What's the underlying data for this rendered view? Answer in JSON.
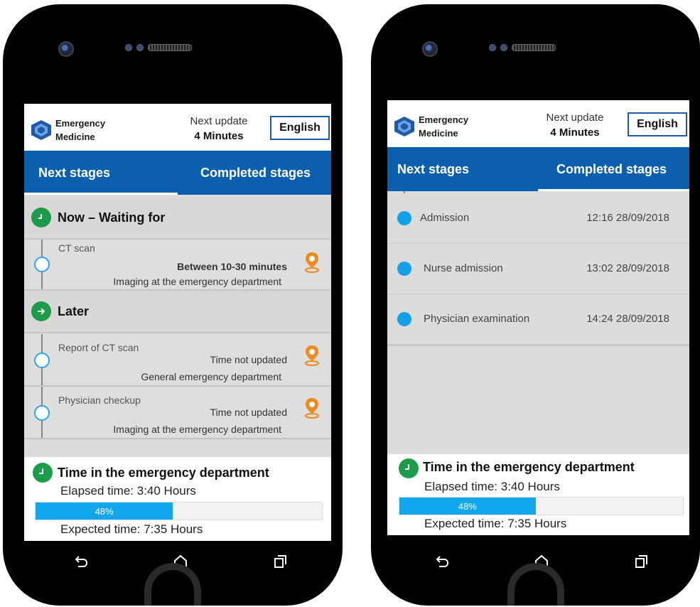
{
  "app": {
    "logo_line1": "Emergency",
    "logo_line2": "Medicine",
    "next_update_label": "Next update",
    "next_update_value": "4 Minutes",
    "language_button": "English"
  },
  "tabs": {
    "next": "Next stages",
    "completed": "Completed stages"
  },
  "left_screen": {
    "active_tab": "next",
    "now_heading": "Now – Waiting for",
    "later_heading": "Later",
    "now_stages": [
      {
        "name": "CT scan",
        "time": "Between 10-30 minutes",
        "location": "Imaging at the emergency department"
      }
    ],
    "later_stages": [
      {
        "name": "Report of CT scan",
        "time": "Time not updated",
        "location": "General emergency department"
      },
      {
        "name": "Physician checkup",
        "time": "Time not updated",
        "location": "Imaging at the emergency department"
      }
    ]
  },
  "right_screen": {
    "active_tab": "completed",
    "completed_stages": [
      {
        "name": "Admission",
        "time": "12:16 28/09/2018"
      },
      {
        "name": "Nurse admission",
        "time": "13:02 28/09/2018"
      },
      {
        "name": "Physician examination",
        "time": "14:24 28/09/2018"
      }
    ]
  },
  "footer": {
    "title": "Time in the emergency department",
    "elapsed_label": "Elapsed time:",
    "elapsed_value": "3:40 Hours",
    "progress_percent": 48,
    "progress_label": "48%",
    "expected_label": "Expected time:",
    "expected_value": "7:35 Hours"
  },
  "colors": {
    "tab_bar": "#0b5fad",
    "status_green": "#1c9b48",
    "progress_blue": "#12a7ec",
    "pin_orange": "#f08a1c"
  },
  "icons": {
    "logo": "hexagon-logo-icon",
    "clock": "clock-icon",
    "arrow": "arrow-right-icon",
    "pin": "location-pin-icon",
    "back": "back-icon",
    "home": "home-icon",
    "recent": "recent-apps-icon"
  }
}
